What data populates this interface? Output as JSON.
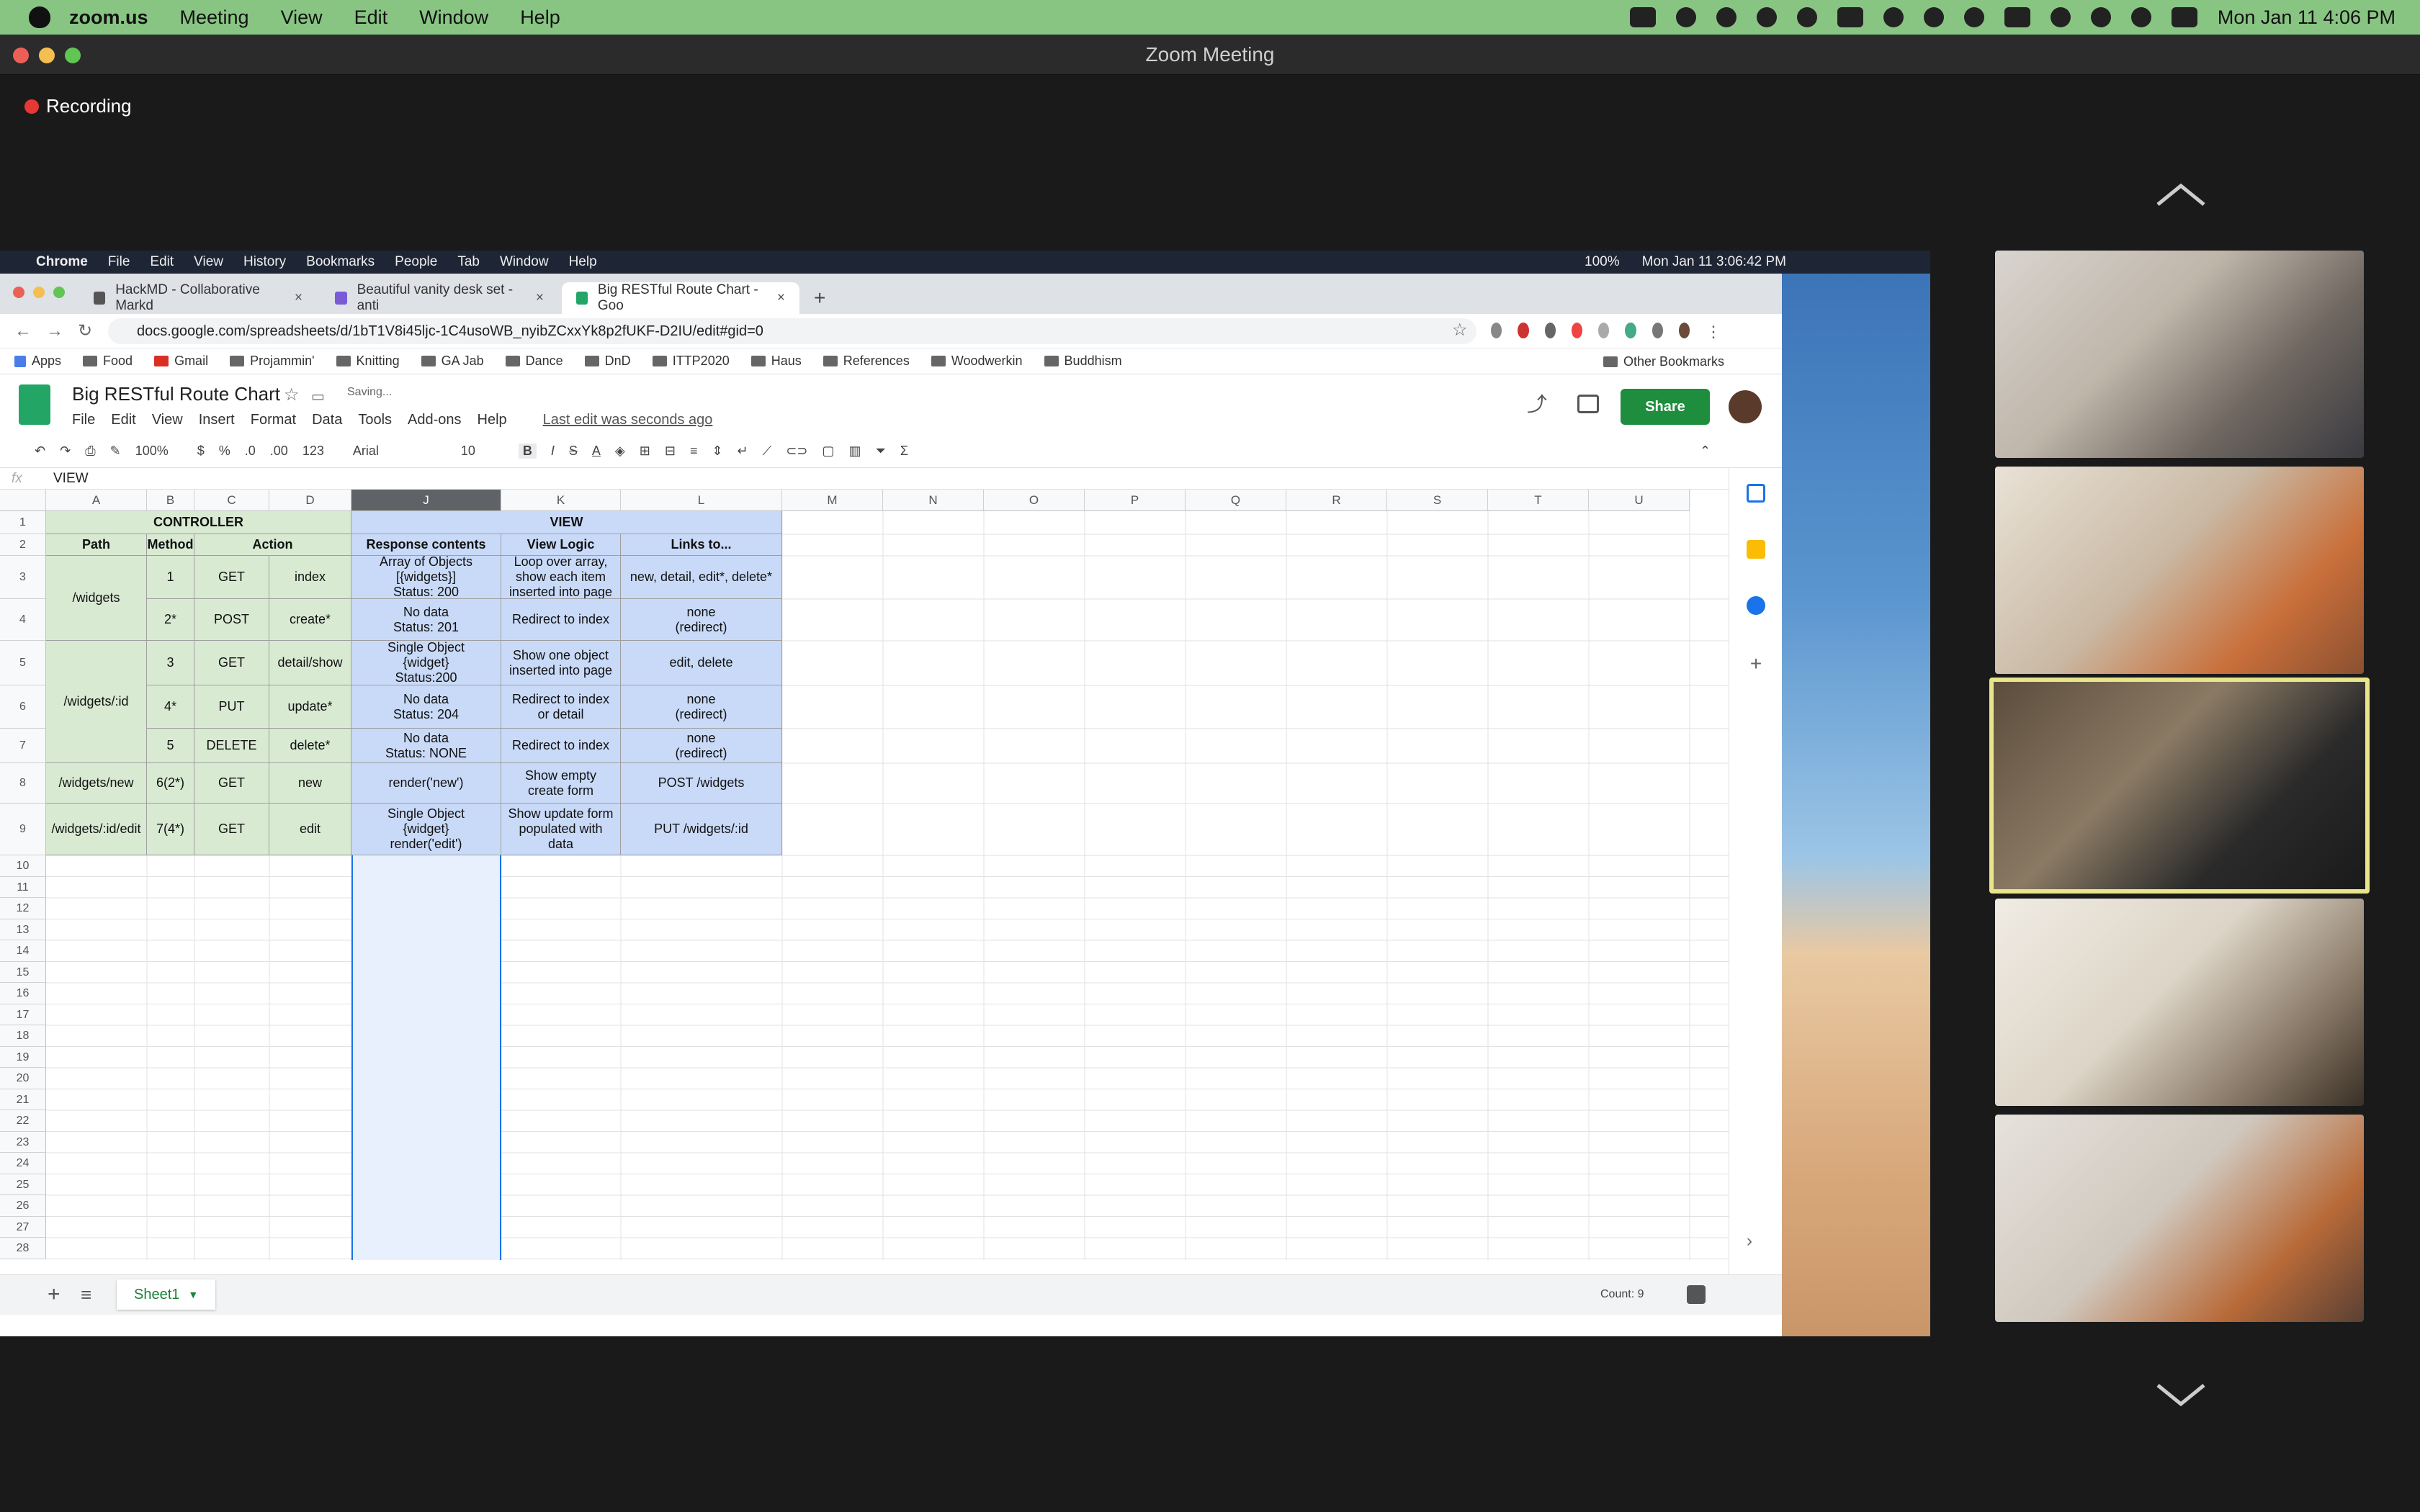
{
  "mac_menu": {
    "app": "zoom.us",
    "items": [
      "Meeting",
      "View",
      "Edit",
      "Window",
      "Help"
    ],
    "clock": "Mon Jan 11  4:06 PM"
  },
  "zoom": {
    "window_title": "Zoom Meeting",
    "recording_label": "Recording"
  },
  "chrome_menu": {
    "app": "Chrome",
    "items": [
      "File",
      "Edit",
      "View",
      "History",
      "Bookmarks",
      "People",
      "Tab",
      "Window",
      "Help"
    ],
    "battery": "100%",
    "clock": "Mon Jan 11  3:06:42 PM"
  },
  "browser": {
    "tabs": [
      {
        "label": "HackMD - Collaborative Markd"
      },
      {
        "label": "Beautiful vanity desk set - anti"
      },
      {
        "label": "Big RESTful Route Chart - Goo"
      }
    ],
    "url": "docs.google.com/spreadsheets/d/1bT1V8i45ljc-1C4usoWB_nyibZCxxYk8p2fUKF-D2IU/edit#gid=0",
    "bookmarks": [
      "Apps",
      "Food",
      "Gmail",
      "Projammin'",
      "Knitting",
      "GA Jab",
      "Dance",
      "DnD",
      "ITTP2020",
      "Haus",
      "References",
      "Woodwerkin",
      "Buddhism"
    ],
    "other_bookmarks": "Other Bookmarks"
  },
  "sheets": {
    "title": "Big RESTful Route Chart",
    "status": "Saving...",
    "menus": [
      "File",
      "Edit",
      "View",
      "Insert",
      "Format",
      "Data",
      "Tools",
      "Add-ons",
      "Help"
    ],
    "last_edit": "Last edit was seconds ago",
    "share_label": "Share",
    "toolbar": {
      "zoom": "100%",
      "currency": "$",
      "percent": "%",
      "dec_less": ".0",
      "dec_more": ".00",
      "format": "123",
      "font": "Arial",
      "size": "10"
    },
    "formula_value": "VIEW",
    "columns": [
      "A",
      "B",
      "C",
      "D",
      "J",
      "K",
      "L",
      "M",
      "N",
      "O",
      "P",
      "Q",
      "R",
      "S",
      "T",
      "U"
    ],
    "selected_column": "J",
    "group_headers": {
      "controller": "CONTROLLER",
      "view": "VIEW"
    },
    "header_row": [
      "Path",
      "Method",
      "Action",
      "Response contents",
      "View Logic",
      "Links to..."
    ],
    "paths": {
      "widgets": "/widgets",
      "widgets_id": "/widgets/:id",
      "widgets_new": "/widgets/new",
      "widgets_edit": "/widgets/:id/edit"
    },
    "rows": [
      {
        "n": "1",
        "method": "GET",
        "action": "index",
        "response": "Array of Objects\n[{widgets}]\nStatus: 200",
        "logic": "Loop over array,\nshow each item\ninserted into page",
        "links": "new, detail, edit*, delete*"
      },
      {
        "n": "2*",
        "method": "POST",
        "action": "create*",
        "response": "No data\nStatus: 201",
        "logic": "Redirect to index",
        "links": "none\n(redirect)"
      },
      {
        "n": "3",
        "method": "GET",
        "action": "detail/show",
        "response": "Single Object\n{widget}\nStatus:200",
        "logic": "Show one object\ninserted into page",
        "links": "edit, delete"
      },
      {
        "n": "4*",
        "method": "PUT",
        "action": "update*",
        "response": "No data\nStatus: 204",
        "logic": "Redirect to index\nor detail",
        "links": "none\n(redirect)"
      },
      {
        "n": "5",
        "method": "DELETE",
        "action": "delete*",
        "response": "No data\nStatus: NONE",
        "logic": "Redirect to index",
        "links": "none\n(redirect)"
      },
      {
        "n": "6(2*)",
        "method": "GET",
        "action": "new",
        "response": "render('new')",
        "logic": "Show empty\ncreate form",
        "links": "POST /widgets"
      },
      {
        "n": "7(4*)",
        "method": "GET",
        "action": "edit",
        "response": "Single Object\n{widget}\nrender('edit')",
        "logic": "Show update form\npopulated with\ndata",
        "links": "PUT /widgets/:id"
      }
    ],
    "row_numbers": [
      "1",
      "2",
      "3",
      "4",
      "5",
      "6",
      "7",
      "8",
      "9",
      "10",
      "11",
      "12",
      "13",
      "14",
      "15",
      "16",
      "17",
      "18",
      "19",
      "20",
      "21",
      "22",
      "23",
      "24",
      "25",
      "26",
      "27",
      "28"
    ],
    "sheet_tab": "Sheet1",
    "count_label": "Count: 9"
  },
  "colors": {
    "mac_bar": "#88c583",
    "controller_fill": "#d9ead3",
    "view_fill": "#c9daf8",
    "share_button": "#1e8e3e",
    "active_speaker": "#e8e58a",
    "recording_dot": "#e53935"
  }
}
